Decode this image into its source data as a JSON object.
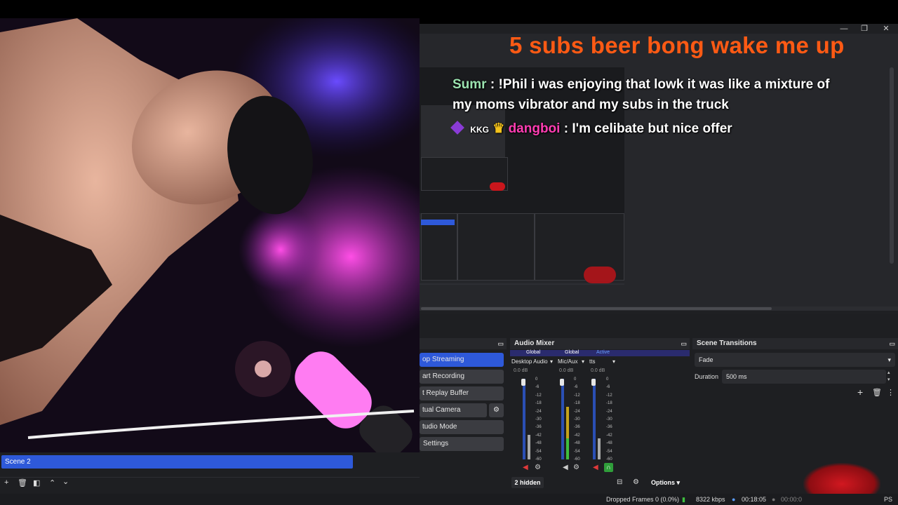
{
  "overlay": {
    "title": "5 subs beer bong wake me up",
    "chat": [
      {
        "user": "Sumr",
        "text": ": !Phil i was enjoying that lowk it was like a mixture of",
        "cont": "my moms vibrator and my subs in the truck"
      },
      {
        "badge": "KKG",
        "user": "dangboi",
        "text": ": I'm celibate but nice offer"
      }
    ]
  },
  "window_controls": {
    "min": "—",
    "max": "❐",
    "close": "✕"
  },
  "controls": {
    "items": [
      {
        "label": "op Streaming",
        "active": true
      },
      {
        "label": "art Recording",
        "active": false
      },
      {
        "label": "t Replay Buffer",
        "active": false
      },
      {
        "label": "tual Camera",
        "active": false
      },
      {
        "label": "tudio Mode",
        "active": false
      },
      {
        "label": "Settings",
        "active": false
      }
    ]
  },
  "audio_mixer": {
    "title": "Audio Mixer",
    "channels": [
      {
        "scope": "Global",
        "name": "Desktop Audio",
        "db": "0.0 dB"
      },
      {
        "scope": "Global",
        "name": "Mic/Aux",
        "db": "0.0 dB"
      },
      {
        "scope": "Active",
        "name": "tts",
        "db": "0.0 dB"
      }
    ],
    "ticks": [
      "0",
      "-6",
      "-12",
      "-18",
      "-24",
      "-30",
      "-36",
      "-42",
      "-48",
      "-54",
      "-60"
    ],
    "hidden": "2 hidden",
    "options": "Options"
  },
  "scene_transitions": {
    "title": "Scene Transitions",
    "transition": "Fade",
    "duration_label": "Duration",
    "duration_value": "500 ms"
  },
  "scenes": {
    "selected": "Scene 2"
  },
  "status": {
    "dropped": "Dropped Frames 0 (0.0%)",
    "kbps": "8322 kbps",
    "time1": "00:18:05",
    "time2": "00:00:0",
    "fps": "PS"
  }
}
